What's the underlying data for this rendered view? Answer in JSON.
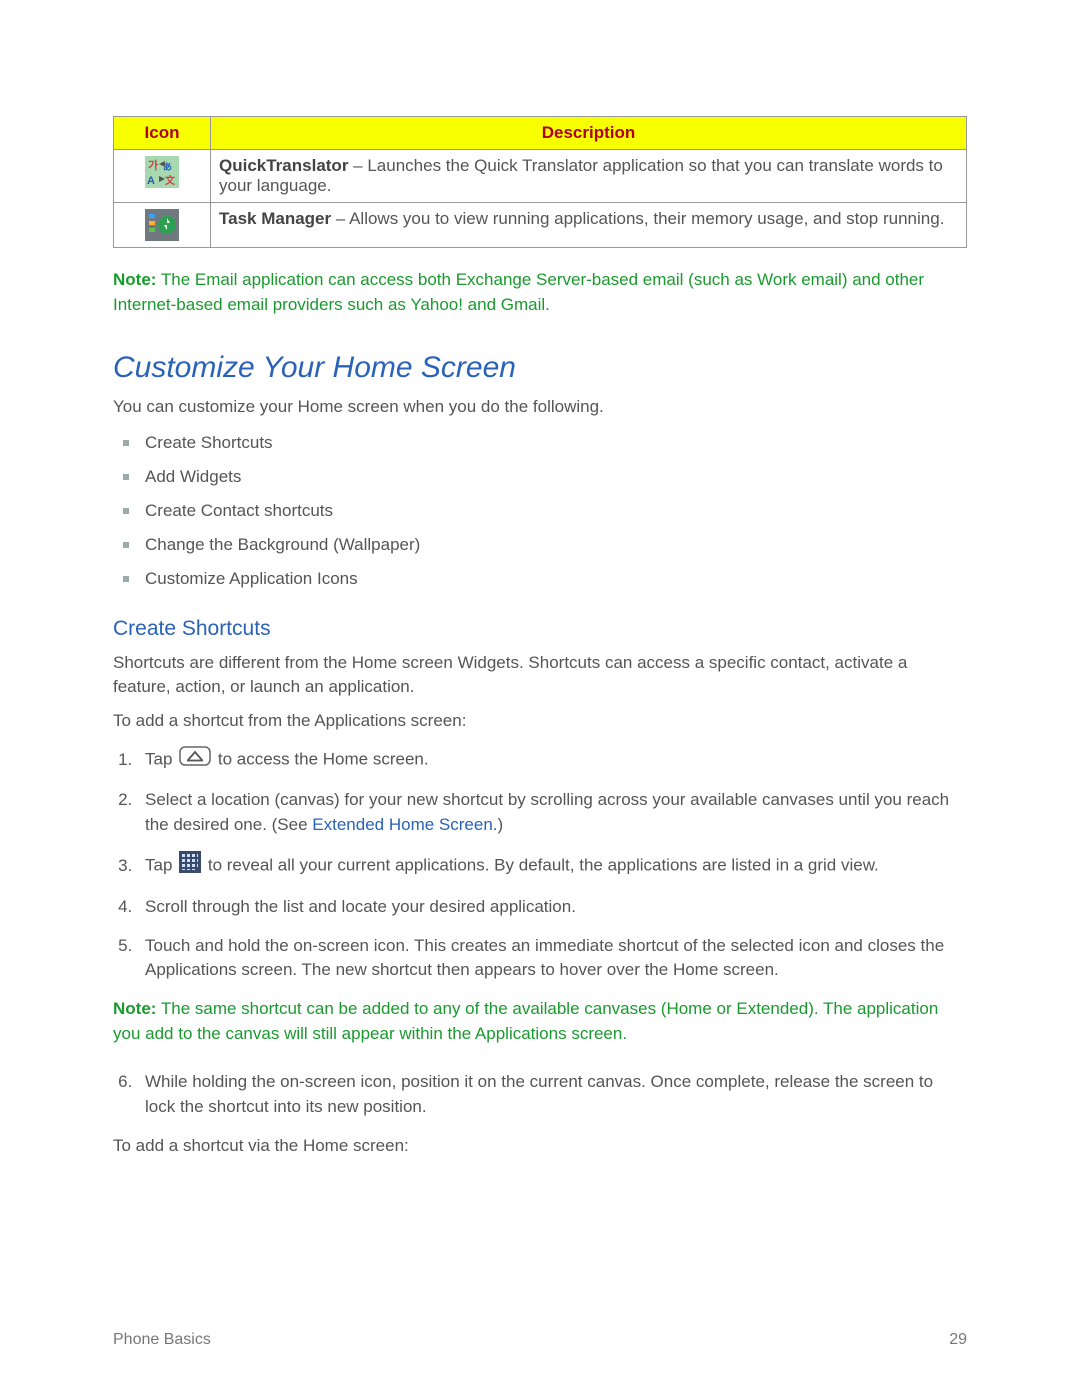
{
  "table": {
    "headers": {
      "icon": "Icon",
      "description": "Description"
    },
    "rows": [
      {
        "name": "QuickTranslator",
        "desc": " – Launches the Quick Translator application so that you can translate words to your language."
      },
      {
        "name": "Task Manager",
        "desc": " – Allows you to view running applications, their memory usage, and stop running."
      }
    ]
  },
  "note1": {
    "label": "Note:",
    "text": " The Email application can access both Exchange Server-based email (such as Work email) and other Internet-based email providers such as Yahoo! and Gmail."
  },
  "section": {
    "title": "Customize Your Home Screen",
    "intro": "You can customize your Home screen when you do the following.",
    "bullets": [
      "Create Shortcuts",
      "Add Widgets",
      "Create Contact shortcuts",
      "Change the Background (Wallpaper)",
      "Customize Application Icons"
    ]
  },
  "subsection": {
    "title": "Create Shortcuts",
    "intro": "Shortcuts are different from the Home screen Widgets. Shortcuts can access a specific contact, activate a feature, action, or launch an application.",
    "lead": "To add a shortcut from the Applications screen:",
    "step1_a": "Tap ",
    "step1_b": " to access the Home screen.",
    "step2_a": "Select a location (canvas) for your new shortcut by scrolling across your available canvases until you reach the desired one. (See ",
    "step2_link": "Extended Home Screen.",
    "step2_b": ")",
    "step3_a": "Tap ",
    "step3_b": " to reveal all your current applications. By default, the applications are listed in a grid view.",
    "step4": "Scroll through the list and locate your desired application.",
    "step5": "Touch and hold the on-screen icon. This creates an immediate shortcut of the selected icon and closes the Applications screen. The new shortcut then appears to hover over the Home screen.",
    "step6": "While holding the on-screen icon, position it on the current canvas. Once complete, release the screen to lock the shortcut into its new position.",
    "lead2": "To add a shortcut via the Home screen:"
  },
  "note2": {
    "label": "Note:",
    "text": " The same shortcut can be added to any of the available canvases (Home or Extended). The application you add to the canvas will still appear within the Applications screen."
  },
  "footer": {
    "left": "Phone Basics",
    "right": "29"
  }
}
